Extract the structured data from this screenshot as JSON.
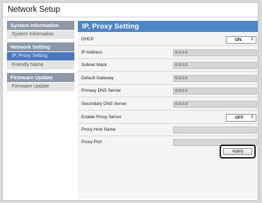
{
  "window": {
    "title": "Network Setup"
  },
  "sidebar": {
    "sections": [
      {
        "heading": "System Information",
        "items": [
          {
            "label": "System Information"
          }
        ]
      },
      {
        "heading": "Network Setting",
        "items": [
          {
            "label": "IP, Proxy Setting"
          },
          {
            "label": "Friendly Name"
          }
        ]
      },
      {
        "heading": "Firmware Update",
        "items": [
          {
            "label": "Firmware Update"
          }
        ]
      }
    ]
  },
  "main": {
    "header": "IP, Proxy Setting",
    "dhcp": {
      "label": "DHCP",
      "value": "ON"
    },
    "ip_address": {
      "label": "IP Address",
      "value": "0.0.0.0"
    },
    "subnet_mask": {
      "label": "Subnet Mask",
      "value": "0.0.0.0"
    },
    "default_gateway": {
      "label": "Default Gateway",
      "value": "0.0.0.0"
    },
    "primary_dns": {
      "label": "Primary DNS Server",
      "value": "0.0.0.0"
    },
    "secondary_dns": {
      "label": "Secondary DNS Server",
      "value": "0.0.0.0"
    },
    "enable_proxy": {
      "label": "Enable Proxy Server",
      "value": "OFF"
    },
    "proxy_host": {
      "label": "Proxy Host Name",
      "value": ""
    },
    "proxy_port": {
      "label": "Proxy Port",
      "value": ""
    },
    "apply_label": "Apply"
  },
  "colors": {
    "header_blue": "#4a86c9",
    "sidebar_section": "#8c97a8",
    "active_item": "#4a78c2"
  },
  "icons": {
    "dropdown": "updown-arrow-icon"
  }
}
